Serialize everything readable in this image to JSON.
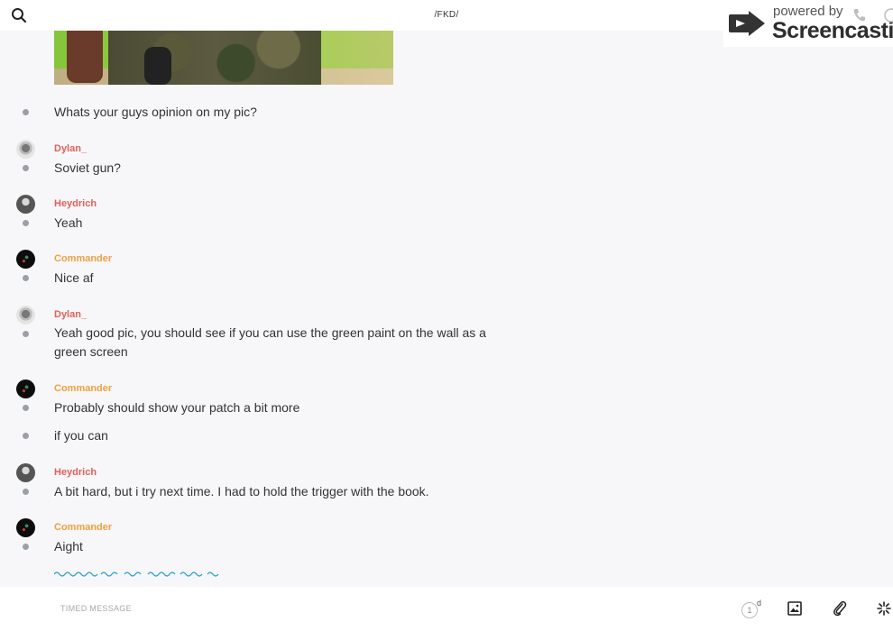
{
  "header": {
    "room_title": "/FKD/",
    "watermark_small": "powered by",
    "watermark_big": "Screencastify"
  },
  "messages": [
    {
      "text": "Whats your guys opinion on my pic?"
    },
    {
      "sender": "Dylan_",
      "text": "Soviet gun?"
    },
    {
      "sender": "Heydrich",
      "text": "Yeah"
    },
    {
      "sender": "Commander",
      "text": "Nice af"
    },
    {
      "sender": "Dylan_",
      "text": "Yeah good pic, you should see if you can use the green paint on the wall as a green screen"
    },
    {
      "sender": "Commander",
      "text": "Probably should show your patch a bit more"
    },
    {
      "text": "if you can"
    },
    {
      "sender": "Heydrich",
      "text": "A bit hard, but i try next time. I had to hold the trigger with the book."
    },
    {
      "sender": "Commander",
      "text": "Aight"
    }
  ],
  "composer": {
    "placeholder": "TIMED MESSAGE",
    "ttl_value": "1",
    "ttl_unit": "d"
  },
  "colors": {
    "sender_red": "#e0605a",
    "sender_orange": "#f0a040",
    "typing_indicator": "#2a9fd6"
  },
  "icons": [
    "search-icon",
    "phone-icon",
    "info-icon",
    "image-icon",
    "paperclip-icon",
    "sparkle-icon",
    "screencastify-logo-icon"
  ]
}
